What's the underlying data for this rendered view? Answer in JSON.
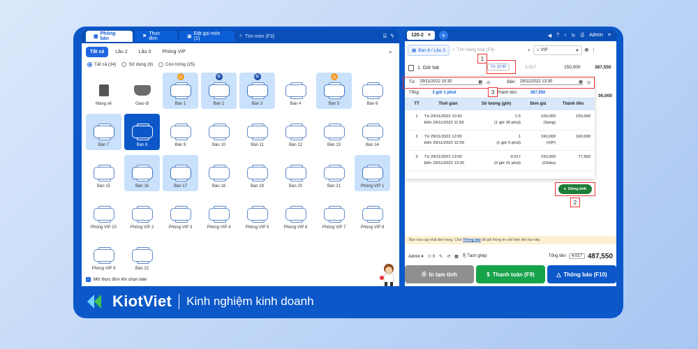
{
  "left_tabs": [
    {
      "label": "Phòng bàn"
    },
    {
      "label": "Thực đơn"
    },
    {
      "label": "Đặt gọi món (1)"
    }
  ],
  "search_placeholder": "Tìm món (F3)",
  "filters": [
    "Tất cả",
    "Lầu 2",
    "Lầu 3",
    "Phòng VIP"
  ],
  "radios": [
    "Tất cả (34)",
    "Sử dụng (9)",
    "Còn trống (25)"
  ],
  "cells": [
    {
      "label": "Mang về",
      "type": "bag"
    },
    {
      "label": "Giao đi",
      "type": "scoot"
    },
    {
      "label": "Bàn 1",
      "state": "used",
      "badge": "o"
    },
    {
      "label": "Bàn 2",
      "state": "used",
      "badge": "b"
    },
    {
      "label": "Bàn 3",
      "state": "used",
      "badge": "b"
    },
    {
      "label": "Bàn 4"
    },
    {
      "label": "Bàn 5",
      "state": "used",
      "badge": "o"
    },
    {
      "label": "Bàn 6"
    },
    {
      "label": "Bàn 7",
      "state": "used"
    },
    {
      "label": "Bàn 8",
      "state": "sel"
    },
    {
      "label": "Bàn 9"
    },
    {
      "label": "Bàn 10"
    },
    {
      "label": "Bàn 11"
    },
    {
      "label": "Bàn 12"
    },
    {
      "label": "Bàn 13"
    },
    {
      "label": "Bàn 14"
    },
    {
      "label": "Bàn 15"
    },
    {
      "label": "Bàn 16",
      "state": "used"
    },
    {
      "label": "Bàn 17",
      "state": "used"
    },
    {
      "label": "Bàn 18"
    },
    {
      "label": "Bàn 19"
    },
    {
      "label": "Bàn 20"
    },
    {
      "label": "Bàn 21"
    },
    {
      "label": "Phòng VIP 1",
      "state": "used"
    },
    {
      "label": "Phòng VIP 10"
    },
    {
      "label": "Phòng VIP 2"
    },
    {
      "label": "Phòng VIP 3"
    },
    {
      "label": "Phòng VIP 4"
    },
    {
      "label": "Phòng VIP 5"
    },
    {
      "label": "Phòng VIP 6"
    },
    {
      "label": "Phòng VIP 7"
    },
    {
      "label": "Phòng VIP 8"
    },
    {
      "label": "Phòng VIP 9"
    },
    {
      "label": "Bàn 22"
    }
  ],
  "open_menu_label": "Mở thực đơn khi chọn bàn",
  "right": {
    "tab": "120-2",
    "user": "Admin",
    "table_btn": "Bàn 8 / Lầu 3",
    "goods_placeholder": "Tìm hàng hóa (F4)",
    "price_list": "VIP",
    "item": {
      "name": "1. Giờ hát",
      "time": "Từ 10:30",
      "qty": "3.017",
      "unit": "150,000",
      "amount": "387,550"
    },
    "from_label": "Từ:",
    "from_value": "29/11/2022 10:30",
    "to_label": "Đến:",
    "to_value": "29/11/2022 13:30",
    "total_label": "Tổng:",
    "total_value": "3 giờ 1 phút",
    "money_label": "Thành tiền:",
    "money_value": "387,550",
    "side_amount": "00,000",
    "headers": [
      "TT",
      "Thời gian",
      "Số lượng (giờ)",
      "Đơn giá",
      "Thành tiền"
    ],
    "rows": [
      {
        "tt": "1",
        "t1": "Từ 29/11/2022 10:30",
        "t2": "Đến 29/11/2022 11:59",
        "q1": "1.5",
        "q2": "(1 giờ 30 phút)",
        "p1": "100,000",
        "p2": "(Sáng)",
        "a": "150,000"
      },
      {
        "tt": "2",
        "t1": "Từ 29/11/2022 12:00",
        "t2": "Đến 29/11/2022 12:59",
        "q1": "1",
        "q2": "(1 giờ 0 phút)",
        "p1": "160,000",
        "p2": "(VIP)",
        "a": "160,000"
      },
      {
        "tt": "3",
        "t1": "Từ 29/11/2022 13:00",
        "t2": "Đến 29/11/2022 13:30",
        "q1": "0.517",
        "q2": "(0 giờ 31 phút)",
        "p1": "150,000",
        "p2": "(Chiều)",
        "a": "77,550"
      }
    ],
    "stop_btn": "Dừng tính",
    "notice_a": "Bạn vừa cập nhật đơn hàng. Click ",
    "notice_link": "Thông báo",
    "notice_b": " để gửi thông tin chế biến đến bar bếp.",
    "footer_user": "Admin",
    "footer_count": "0",
    "split": "Tách ghép",
    "total_money_label": "Tổng tiền",
    "total_count": "4.017",
    "total_money": "487,550",
    "btn_print": "In tạm tính",
    "btn_pay": "Thanh toán (F9)",
    "btn_notify": "Thông báo (F10)"
  },
  "markers": [
    "1",
    "2",
    "3"
  ],
  "brand": {
    "name": "KiotViet",
    "tagline": "Kinh nghiệm kinh doanh"
  }
}
